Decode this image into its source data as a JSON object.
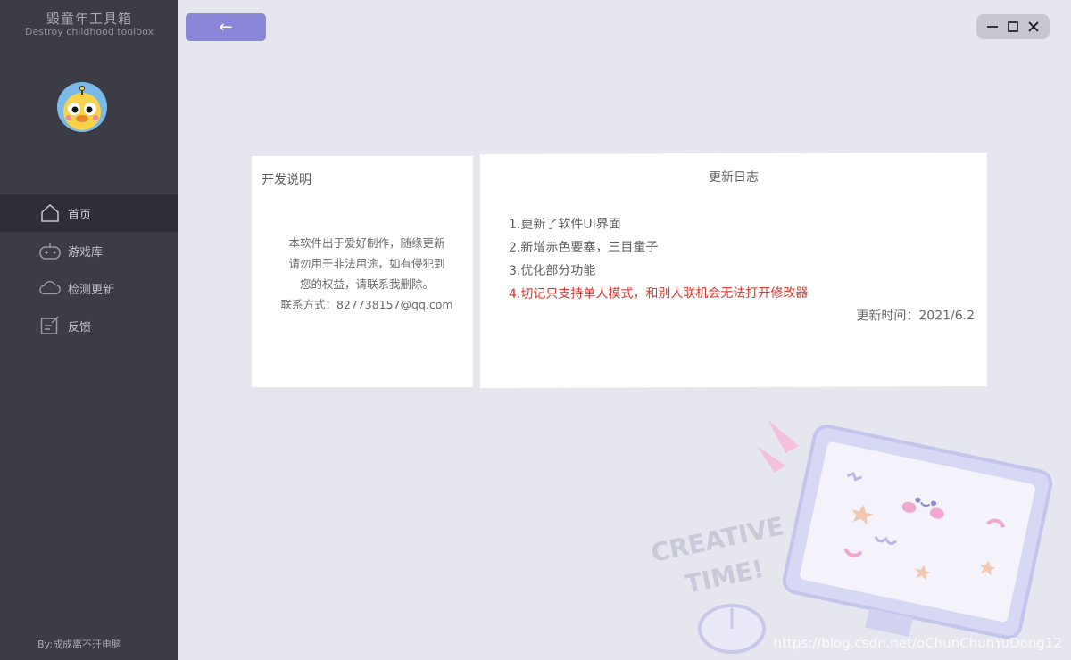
{
  "app": {
    "title": "毁童年工具箱",
    "subtitle": "Destroy childhood toolbox",
    "credit": "By:成成离不开电脑"
  },
  "nav": [
    {
      "label": "首页",
      "icon": "home-icon",
      "active": true
    },
    {
      "label": "游戏库",
      "icon": "gamepad-icon",
      "active": false
    },
    {
      "label": "检测更新",
      "icon": "cloud-icon",
      "active": false
    },
    {
      "label": "反馈",
      "icon": "feedback-icon",
      "active": false
    }
  ],
  "toolbar": {
    "back_label": "←"
  },
  "window": {
    "minimize": "—",
    "maximize": "☐",
    "close": "✕"
  },
  "dev_card": {
    "title": "开发说明",
    "lines": [
      "本软件出于爱好制作，随缘更新",
      "请勿用于非法用途，如有侵犯到",
      "您的权益，请联系我删除。",
      "联系方式：827738157@qq.com"
    ]
  },
  "log_card": {
    "title": "更新日志",
    "items": [
      "1.更新了软件UI界面",
      "2.新增赤色要塞，三目童子",
      "3.优化部分功能",
      "4.切记只支持单人模式，和别人联机会无法打开修改器"
    ],
    "time": "更新时间：2021/6.2"
  },
  "decoration": {
    "text": "CREATIVE TIME!"
  },
  "watermark": "https://blog.csdn.net/oChunChunYuDong12",
  "colors": {
    "sidebar": "#3b3c45",
    "accent": "#8b87d8",
    "warning": "#d9372f",
    "background": "#e6e6ee"
  }
}
